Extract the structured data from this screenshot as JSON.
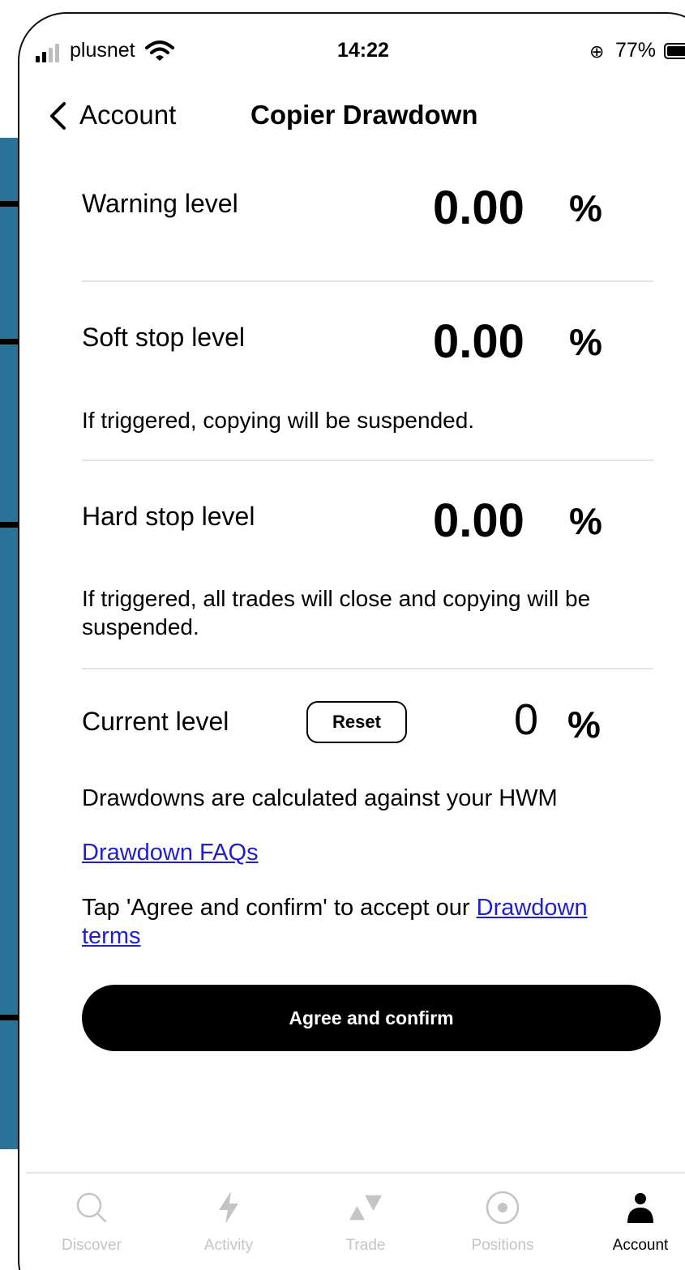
{
  "status_bar": {
    "carrier": "plusnet",
    "time": "14:22",
    "battery": "77%"
  },
  "nav": {
    "back_label": "Account",
    "title": "Copier Drawdown"
  },
  "levels": {
    "warning": {
      "label": "Warning level",
      "value": "0.00",
      "unit": "%"
    },
    "soft_stop": {
      "label": "Soft stop level",
      "value": "0.00",
      "unit": "%",
      "note": "If triggered, copying will be suspended."
    },
    "hard_stop": {
      "label": "Hard stop level",
      "value": "0.00",
      "unit": "%",
      "note": "If triggered, all trades will close and copying will be suspended."
    },
    "current": {
      "label": "Current level",
      "reset_label": "Reset",
      "value": "0",
      "unit": "%"
    }
  },
  "info": {
    "hwm_text": "Drawdowns are calculated against your HWM",
    "faq_link": "Drawdown FAQs",
    "terms_prefix": "Tap 'Agree and confirm' to accept our ",
    "terms_link": "Drawdown terms"
  },
  "confirm_label": "Agree and confirm",
  "tabs": [
    {
      "label": "Discover",
      "icon": "search-icon",
      "active": false
    },
    {
      "label": "Activity",
      "icon": "lightning-icon",
      "active": false
    },
    {
      "label": "Trade",
      "icon": "trade-icon",
      "active": false
    },
    {
      "label": "Positions",
      "icon": "positions-icon",
      "active": false
    },
    {
      "label": "Account",
      "icon": "person-icon",
      "active": true
    }
  ],
  "colors": {
    "side_band": "#2a7398",
    "link": "#1f1fd1",
    "tab_inactive": "#c4c4c4",
    "tab_active": "#000000"
  }
}
